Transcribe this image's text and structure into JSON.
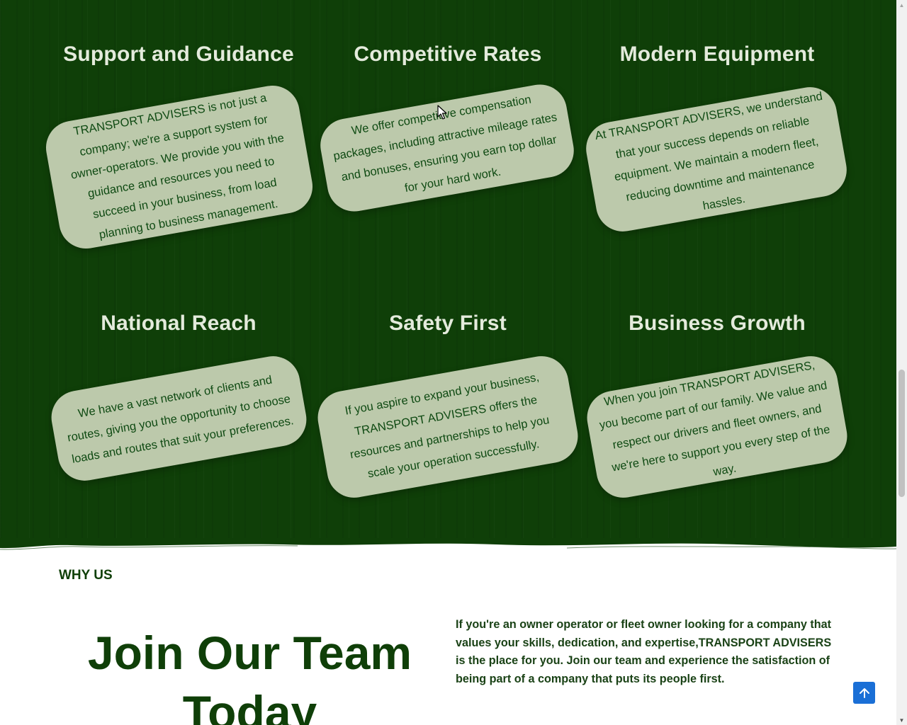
{
  "features": [
    {
      "title": "Support and Guidance",
      "text": "TRANSPORT ADVISERS is not just a company; we're a support system for owner-operators. We provide you with the guidance and resources you need to succeed in your business, from load planning to business management."
    },
    {
      "title": "Competitive Rates",
      "text": "We offer competitive compensation packages, including attractive mileage rates and bonuses, ensuring you earn top dollar for your hard work."
    },
    {
      "title": "Modern Equipment",
      "text": "At TRANSPORT ADVISERS, we understand that your success depends on reliable equipment. We maintain a modern fleet, reducing downtime and maintenance hassles."
    },
    {
      "title": "National Reach",
      "text": "We have a vast network of clients and routes, giving you the opportunity to choose loads and routes that suit your preferences."
    },
    {
      "title": "Safety First",
      "text": "If you aspire to expand your business, TRANSPORT ADVISERS offers the resources and partnerships to help you scale your operation successfully."
    },
    {
      "title": "Business Growth",
      "text": "When you join TRANSPORT ADVISERS, you become part of our family. We value and respect our drivers and fleet owners, and we're here to support you every step of the way."
    }
  ],
  "why_us": {
    "label": "WHY US",
    "title": "Join Our Team Today",
    "text": "If you're an owner operator or fleet owner looking for a company that values your skills, dedication, and expertise,TRANSPORT ADVISERS is the place for you. Join our team and experience the satisfaction of being part of a company that puts its people first."
  },
  "colors": {
    "section_green": "#0f3f08",
    "card_fill": "#bcc9ab",
    "card_text": "#0f4a13",
    "heading_light": "#e4ebdc",
    "back_to_top": "#1a6fd6"
  },
  "icons": {
    "back_to_top": "arrow-up-icon",
    "cursor": "mouse-pointer-icon"
  }
}
